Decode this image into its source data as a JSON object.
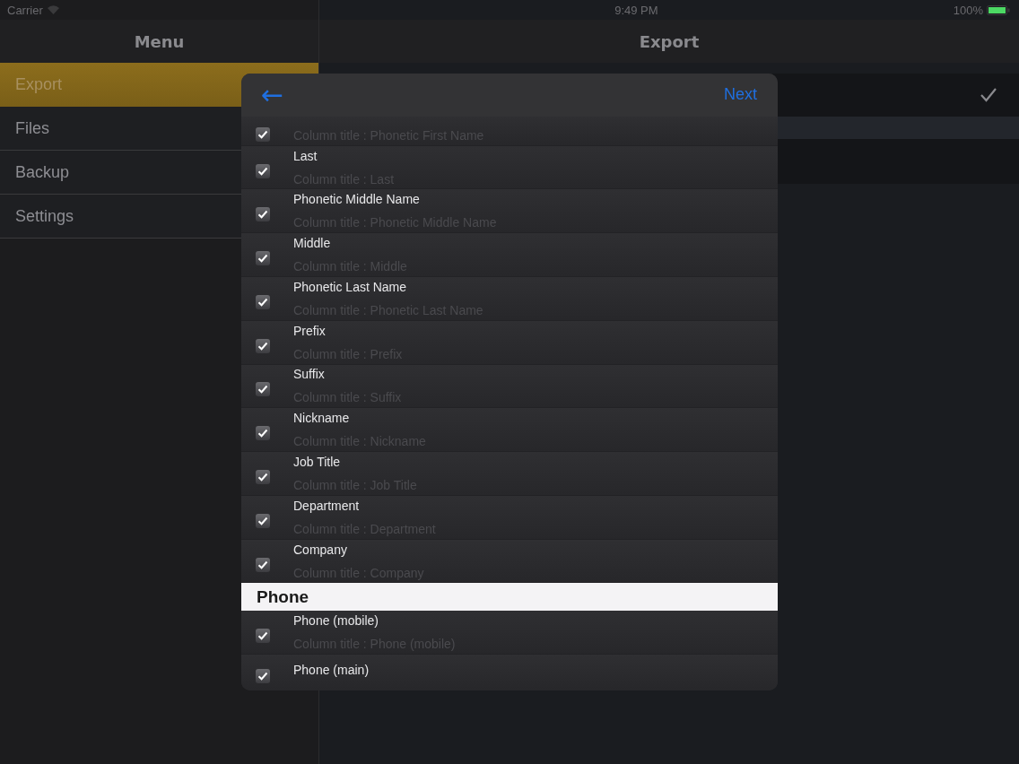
{
  "status_bar": {
    "carrier": "Carrier",
    "time": "9:49 PM",
    "battery": "100%"
  },
  "sidebar": {
    "title": "Menu",
    "items": [
      {
        "label": "Export",
        "selected": true
      },
      {
        "label": "Files",
        "selected": false
      },
      {
        "label": "Backup",
        "selected": false
      },
      {
        "label": "Settings",
        "selected": false
      }
    ]
  },
  "main": {
    "title": "Export",
    "rows": [
      {
        "checked": true
      }
    ]
  },
  "dialog": {
    "back": "←",
    "next": "Next",
    "sections": [
      {
        "rows": [
          {
            "subtitle": "Column title : Phonetic First Name",
            "checked": true
          },
          {
            "title": "Last",
            "subtitle": "Column title : Last",
            "checked": true
          },
          {
            "title": "Phonetic Middle Name",
            "subtitle": "Column title : Phonetic Middle Name",
            "checked": true
          },
          {
            "title": "Middle",
            "subtitle": "Column title : Middle",
            "checked": true
          },
          {
            "title": "Phonetic Last Name",
            "subtitle": "Column title : Phonetic Last Name",
            "checked": true
          },
          {
            "title": "Prefix",
            "subtitle": "Column title : Prefix",
            "checked": true
          },
          {
            "title": "Suffix",
            "subtitle": "Column title : Suffix",
            "checked": true
          },
          {
            "title": "Nickname",
            "subtitle": "Column title : Nickname",
            "checked": true
          },
          {
            "title": "Job Title",
            "subtitle": "Column title : Job Title",
            "checked": true
          },
          {
            "title": "Department",
            "subtitle": "Column title : Department",
            "checked": true
          },
          {
            "title": "Company",
            "subtitle": "Column title : Company",
            "checked": true
          }
        ]
      },
      {
        "header": "Phone",
        "rows": [
          {
            "title": "Phone (mobile)",
            "subtitle": "Column title : Phone (mobile)",
            "checked": true
          },
          {
            "title": "Phone (main)",
            "checked": true
          }
        ]
      }
    ]
  }
}
